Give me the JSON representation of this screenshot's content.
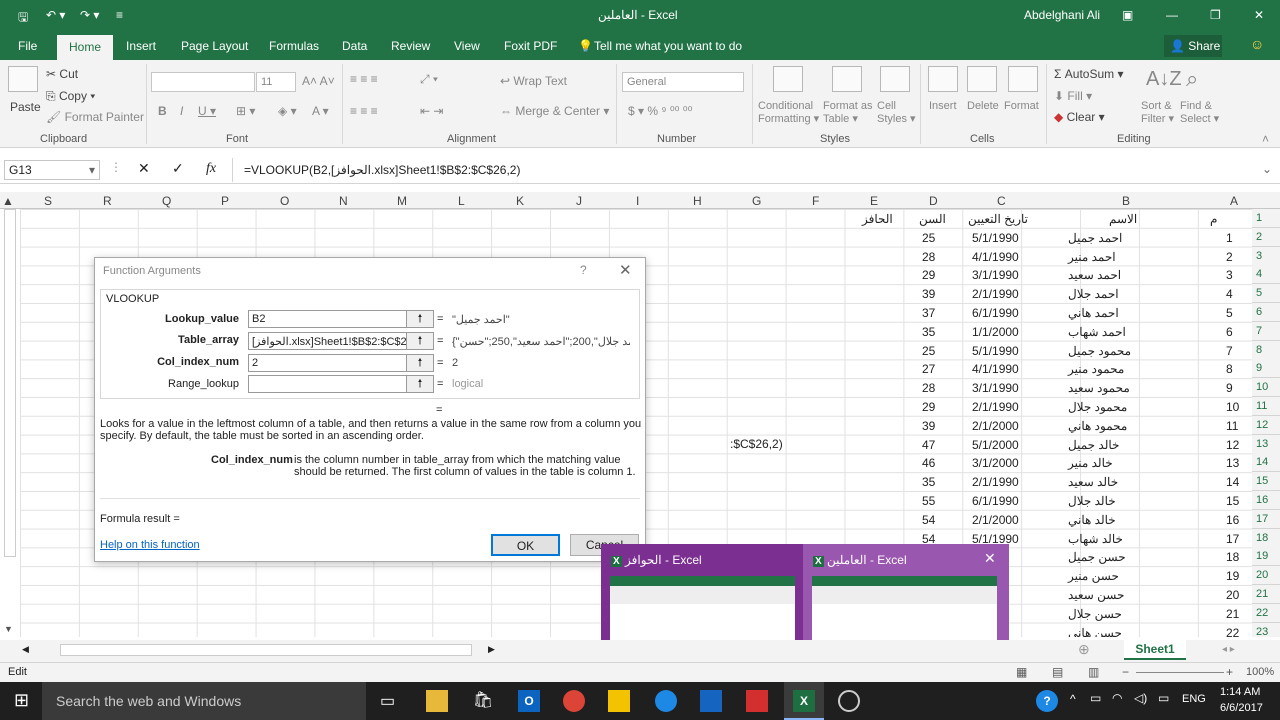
{
  "window": {
    "title": "العاملين - Excel",
    "user": "Abdelghani Ali"
  },
  "tabs": [
    "File",
    "Home",
    "Insert",
    "Page Layout",
    "Formulas",
    "Data",
    "Review",
    "View",
    "Foxit PDF",
    "Tell me what you want to do"
  ],
  "share": "Share",
  "ribbon": {
    "clipboard": {
      "paste": "Paste",
      "cut": "Cut",
      "copy": "Copy",
      "format_painter": "Format Painter",
      "label": "Clipboard"
    },
    "font": {
      "size": "11",
      "label": "Font"
    },
    "alignment": {
      "wrap": "Wrap Text",
      "merge": "Merge & Center",
      "label": "Alignment"
    },
    "number": {
      "format": "General",
      "label": "Number"
    },
    "styles": {
      "cond1": "Conditional",
      "cond2": "Formatting",
      "fmt1": "Format as",
      "fmt2": "Table",
      "cell1": "Cell",
      "cell2": "Styles",
      "label": "Styles"
    },
    "cells": {
      "insert": "Insert",
      "delete": "Delete",
      "format": "Format",
      "label": "Cells"
    },
    "editing": {
      "autosum": "AutoSum",
      "fill": "Fill",
      "clear": "Clear",
      "sort1": "Sort &",
      "sort2": "Filter",
      "find1": "Find &",
      "find2": "Select",
      "label": "Editing"
    }
  },
  "formula_bar": {
    "name_box": "G13",
    "formula": "=VLOOKUP(B2,[الحوافز.xlsx]Sheet1!$B$2:$C$26,2)"
  },
  "columns": [
    "S",
    "R",
    "Q",
    "P",
    "O",
    "N",
    "M",
    "L",
    "K",
    "J",
    "I",
    "H",
    "G",
    "F",
    "E",
    "D",
    "C",
    "B",
    "A"
  ],
  "header_row": {
    "num": "م",
    "name": "الاسم",
    "date": "تاريخ التعيين",
    "age": "السن",
    "bonus": "الحافز"
  },
  "rows": [
    {
      "r": "1"
    },
    {
      "r": "2",
      "n": "1",
      "name": "احمد جميل",
      "date": "5/1/1990",
      "age": "25"
    },
    {
      "r": "3",
      "n": "2",
      "name": "احمد منير",
      "date": "4/1/1990",
      "age": "28"
    },
    {
      "r": "4",
      "n": "3",
      "name": "احمد سعيد",
      "date": "3/1/1990",
      "age": "29"
    },
    {
      "r": "5",
      "n": "4",
      "name": "احمد جلال",
      "date": "2/1/1990",
      "age": "39"
    },
    {
      "r": "6",
      "n": "5",
      "name": "احمد هاني",
      "date": "6/1/1990",
      "age": "37"
    },
    {
      "r": "7",
      "n": "6",
      "name": "احمد شهاب",
      "date": "1/1/2000",
      "age": "35"
    },
    {
      "r": "8",
      "n": "7",
      "name": "محمود جميل",
      "date": "5/1/1990",
      "age": "25"
    },
    {
      "r": "9",
      "n": "8",
      "name": "محمود منير",
      "date": "4/1/1990",
      "age": "27"
    },
    {
      "r": "10",
      "n": "9",
      "name": "محمود سعيد",
      "date": "3/1/1990",
      "age": "28"
    },
    {
      "r": "11",
      "n": "10",
      "name": "محمود جلال",
      "date": "2/1/1990",
      "age": "29"
    },
    {
      "r": "12",
      "n": "11",
      "name": "محمود هاني",
      "date": "2/1/2000",
      "age": "39"
    },
    {
      "r": "13",
      "n": "12",
      "name": "خالد جميل",
      "date": "5/1/2000",
      "age": "47"
    },
    {
      "r": "14",
      "n": "13",
      "name": "خالد منير",
      "date": "3/1/2000",
      "age": "46"
    },
    {
      "r": "15",
      "n": "14",
      "name": "خالد سعيد",
      "date": "2/1/1990",
      "age": "35"
    },
    {
      "r": "16",
      "n": "15",
      "name": "خالد جلال",
      "date": "6/1/1990",
      "age": "55"
    },
    {
      "r": "17",
      "n": "16",
      "name": "خالد هاني",
      "date": "2/1/2000",
      "age": "54"
    },
    {
      "r": "18",
      "n": "17",
      "name": "خالد شهاب",
      "date": "5/1/1990",
      "age": "54"
    },
    {
      "r": "19",
      "n": "18",
      "name": "حسن جميل",
      "date": "990"
    },
    {
      "r": "20",
      "n": "19",
      "name": "حسن منير",
      "date": "990"
    },
    {
      "r": "21",
      "n": "20",
      "name": "حسن سعيد",
      "date": "990"
    },
    {
      "r": "22",
      "n": "21",
      "name": "حسن جلال",
      "date": "990"
    },
    {
      "r": "23",
      "n": "22",
      "name": "حسن هاني",
      "date": "990"
    }
  ],
  "cell_edit_text": ":$C$26,2)",
  "dialog": {
    "title": "Function Arguments",
    "help_q": "?",
    "func": "VLOOKUP",
    "args": [
      {
        "label": "Lookup_value",
        "value": "B2",
        "result": "\"احمد جميل\""
      },
      {
        "label": "Table_array",
        "value": "[الحوافز.xlsx]Sheet1!$B$2:$C$26",
        "result": "{\"احمد جلال\",200;\"احمد سعيد\",250;\"حسن"
      },
      {
        "label": "Col_index_num",
        "value": "2",
        "result": "2"
      },
      {
        "label": "Range_lookup",
        "value": "",
        "result": "logical"
      }
    ],
    "description": "Looks for a value in the leftmost column of a table, and then returns a value in the same row from a column you specify. By default, the table must be sorted in an ascending order.",
    "arg_name": "Col_index_num",
    "arg_desc1": "is the column number in table_array from which the matching value",
    "arg_desc2": "should be returned. The first column of values in the table is column 1.",
    "formula_result": "Formula result =",
    "help_link": "Help on this function",
    "ok": "OK",
    "cancel": "Cancel"
  },
  "thumbnails": [
    {
      "title": "الحوافز - Excel"
    },
    {
      "title": "العاملين - Excel"
    }
  ],
  "sheet_tab": "Sheet1",
  "status": {
    "mode": "Edit",
    "zoom": "100%"
  },
  "taskbar": {
    "search": "Search the web and Windows",
    "lang": "ENG",
    "time": "1:14 AM",
    "date": "6/6/2017"
  }
}
